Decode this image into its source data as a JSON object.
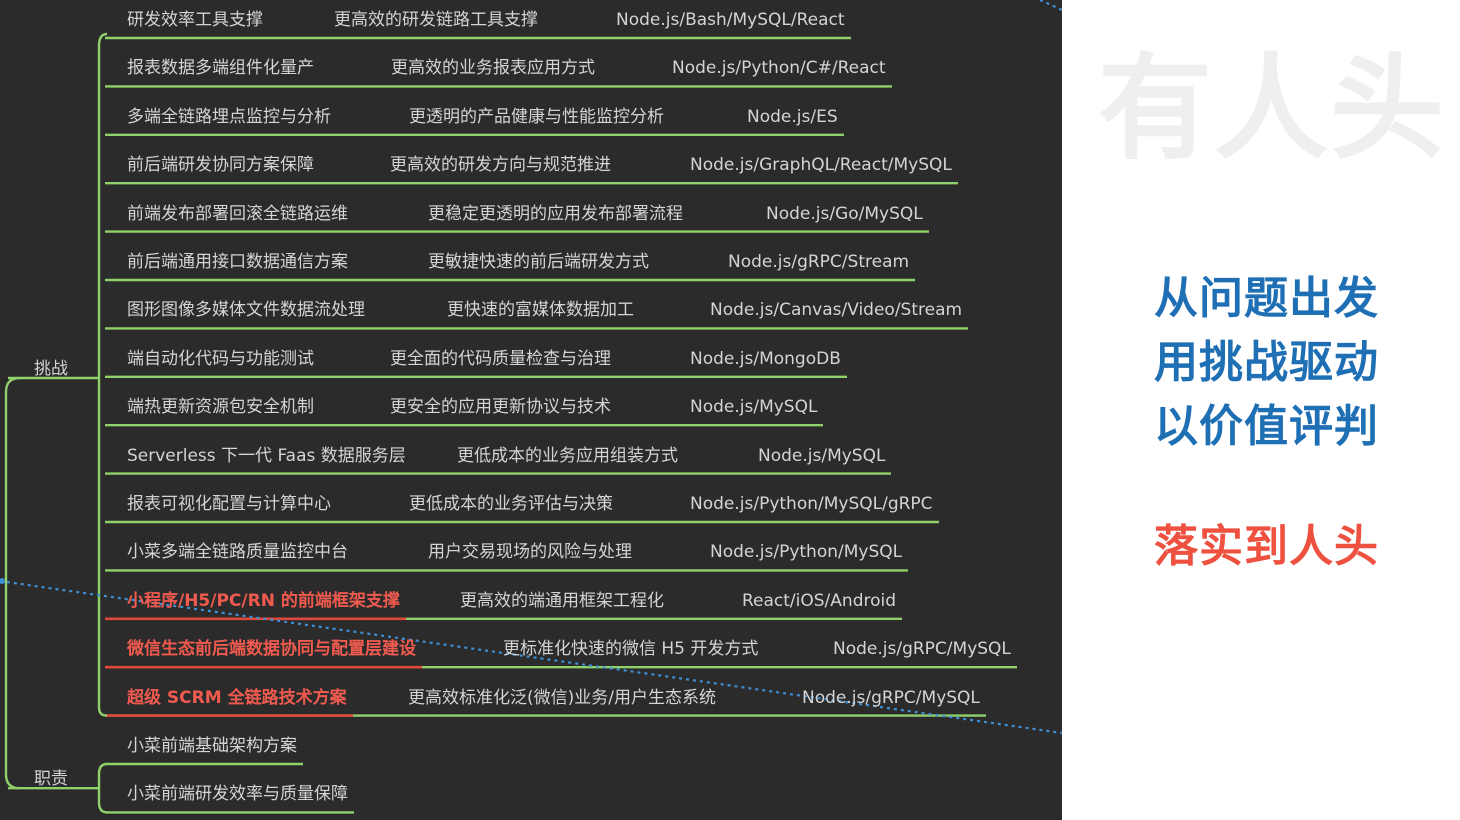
{
  "branches": [
    {
      "label": "挑战",
      "node_name": "branch-challenge"
    },
    {
      "label": "职责",
      "node_name": "branch-duty"
    }
  ],
  "challenges": [
    {
      "topic": "研发效率工具支撑",
      "value": "更高效的研发链路工具支撑",
      "tech": "Node.js/Bash/MySQL/React",
      "highlight": false
    },
    {
      "topic": "报表数据多端组件化量产",
      "value": "更高效的业务报表应用方式",
      "tech": "Node.js/Python/C#/React",
      "highlight": false
    },
    {
      "topic": "多端全链路埋点监控与分析",
      "value": "更透明的产品健康与性能监控分析",
      "tech": "Node.js/ES",
      "highlight": false
    },
    {
      "topic": "前后端研发协同方案保障",
      "value": "更高效的研发方向与规范推进",
      "tech": "Node.js/GraphQL/React/MySQL",
      "highlight": false
    },
    {
      "topic": "前端发布部署回滚全链路运维",
      "value": "更稳定更透明的应用发布部署流程",
      "tech": "Node.js/Go/MySQL",
      "highlight": false
    },
    {
      "topic": "前后端通用接口数据通信方案",
      "value": "更敏捷快速的前后端研发方式",
      "tech": "Node.js/gRPC/Stream",
      "highlight": false
    },
    {
      "topic": "图形图像多媒体文件数据流处理",
      "value": "更快速的富媒体数据加工",
      "tech": "Node.js/Canvas/Video/Stream",
      "highlight": false
    },
    {
      "topic": "端自动化代码与功能测试",
      "value": "更全面的代码质量检查与治理",
      "tech": "Node.js/MongoDB",
      "highlight": false
    },
    {
      "topic": "端热更新资源包安全机制",
      "value": "更安全的应用更新协议与技术",
      "tech": "Node.js/MySQL",
      "highlight": false
    },
    {
      "topic": "Serverless 下一代 Faas 数据服务层",
      "value": "更低成本的业务应用组装方式",
      "tech": "Node.js/MySQL",
      "highlight": false
    },
    {
      "topic": "报表可视化配置与计算中心",
      "value": "更低成本的业务评估与决策",
      "tech": "Node.js/Python/MySQL/gRPC",
      "highlight": false
    },
    {
      "topic": "小菜多端全链路质量监控中台",
      "value": "用户交易现场的风险与处理",
      "tech": "Node.js/Python/MySQL",
      "highlight": false
    },
    {
      "topic": "小程序/H5/PC/RN 的前端框架支撑",
      "value": "更高效的端通用框架工程化",
      "tech": "React/iOS/Android",
      "highlight": true
    },
    {
      "topic": "微信生态前后端数据协同与配置层建设",
      "value": "更标准化快速的微信 H5 开发方式",
      "tech": "Node.js/gRPC/MySQL",
      "highlight": true
    },
    {
      "topic": "超级 SCRM 全链路技术方案",
      "value": "更高效标准化泛(微信)业务/用户生态系统",
      "tech": "Node.js/gRPC/MySQL",
      "highlight": true
    }
  ],
  "duties": [
    {
      "topic": "小菜前端基础架构方案"
    },
    {
      "topic": "小菜前端研发效率与质量保障"
    }
  ],
  "watermark": "有人头",
  "slogans": [
    "从问题出发",
    "用挑战驱动",
    "以价值评判"
  ],
  "slogan_highlight": "落实到人头",
  "colors": {
    "background": "#2b2b2b",
    "text": "#d4d4d4",
    "line": "#8fd16a",
    "highlight_text": "#f05a4f",
    "highlight_line": "#e0483c",
    "dotted": "#3d8fd6",
    "slogan": "#1f6fb5",
    "slogan_highlight": "#ee5140"
  }
}
